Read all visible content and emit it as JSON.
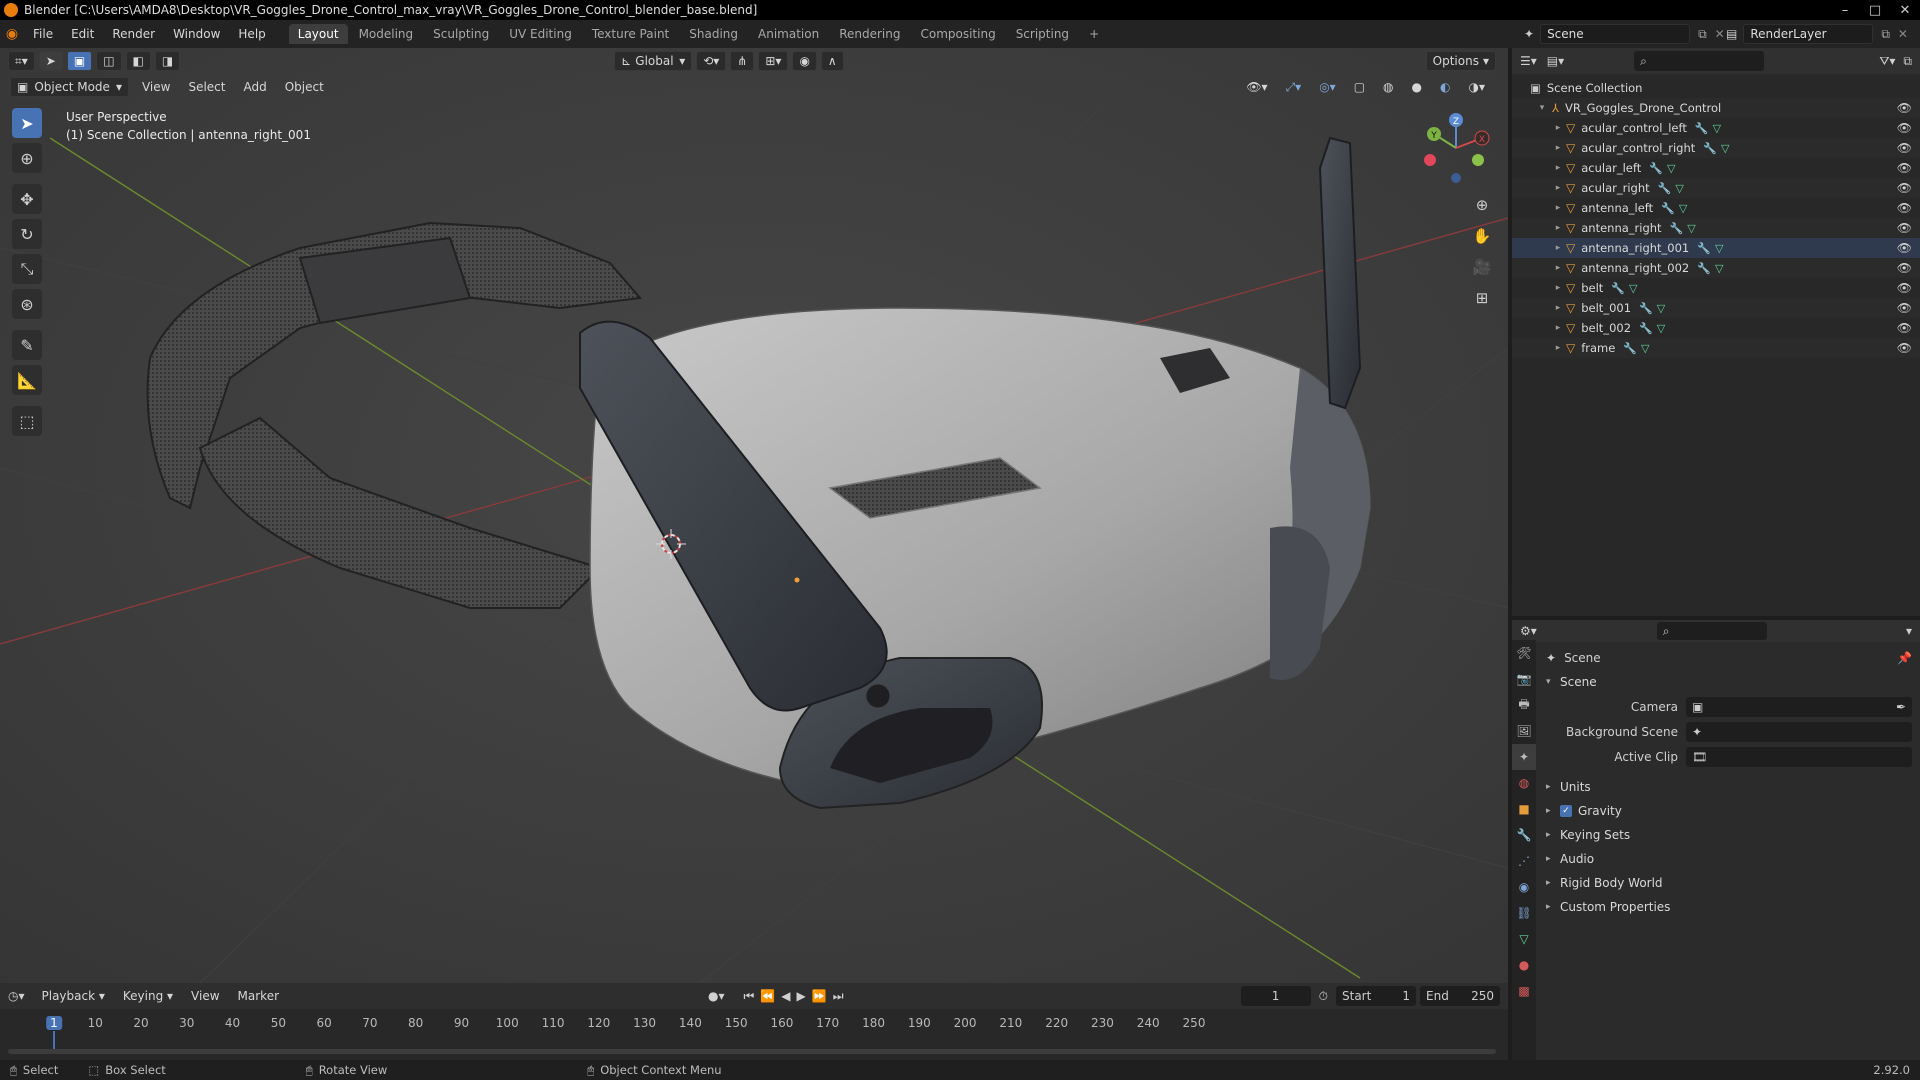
{
  "window": {
    "title": "Blender [C:\\Users\\AMDA8\\Desktop\\VR_Goggles_Drone_Control_max_vray\\VR_Goggles_Drone_Control_blender_base.blend]"
  },
  "menu": [
    "File",
    "Edit",
    "Render",
    "Window",
    "Help"
  ],
  "workspaces": [
    "Layout",
    "Modeling",
    "Sculpting",
    "UV Editing",
    "Texture Paint",
    "Shading",
    "Animation",
    "Rendering",
    "Compositing",
    "Scripting",
    "+"
  ],
  "scene_name": "Scene",
  "view_layer": "RenderLayer",
  "viewport": {
    "orientation": "Global",
    "options_label": "Options",
    "mode": "Object Mode",
    "menus": [
      "View",
      "Select",
      "Add",
      "Object"
    ],
    "overlay_title": "User Perspective",
    "overlay_sub": "(1) Scene Collection | antenna_right_001",
    "gizmo": {
      "x": "X",
      "y": "Y",
      "z": "Z"
    }
  },
  "outliner": {
    "root": "Scene Collection",
    "collection": "VR_Goggles_Drone_Control",
    "items": [
      "acular_control_left",
      "acular_control_right",
      "acular_left",
      "acular_right",
      "antenna_left",
      "antenna_right",
      "antenna_right_001",
      "antenna_right_002",
      "belt",
      "belt_001",
      "belt_002",
      "frame"
    ],
    "selected": "antenna_right_001"
  },
  "properties": {
    "context": "Scene",
    "panel": "Scene",
    "camera_label": "Camera",
    "bg_scene_label": "Background Scene",
    "active_clip_label": "Active Clip",
    "sections": [
      "Units",
      "Gravity",
      "Keying Sets",
      "Audio",
      "Rigid Body World",
      "Custom Properties"
    ]
  },
  "timeline": {
    "menus": [
      "Playback",
      "Keying",
      "View",
      "Marker"
    ],
    "current_frame": "1",
    "start_label": "Start",
    "start": "1",
    "end_label": "End",
    "end": "250",
    "ticks": [
      "1",
      "10",
      "20",
      "30",
      "40",
      "50",
      "60",
      "70",
      "80",
      "90",
      "100",
      "110",
      "120",
      "130",
      "140",
      "150",
      "160",
      "170",
      "180",
      "190",
      "200",
      "210",
      "220",
      "230",
      "240",
      "250"
    ]
  },
  "status": {
    "select": "Select",
    "box_select": "Box Select",
    "rotate_view": "Rotate View",
    "context_menu": "Object Context Menu",
    "version": "2.92.0"
  }
}
